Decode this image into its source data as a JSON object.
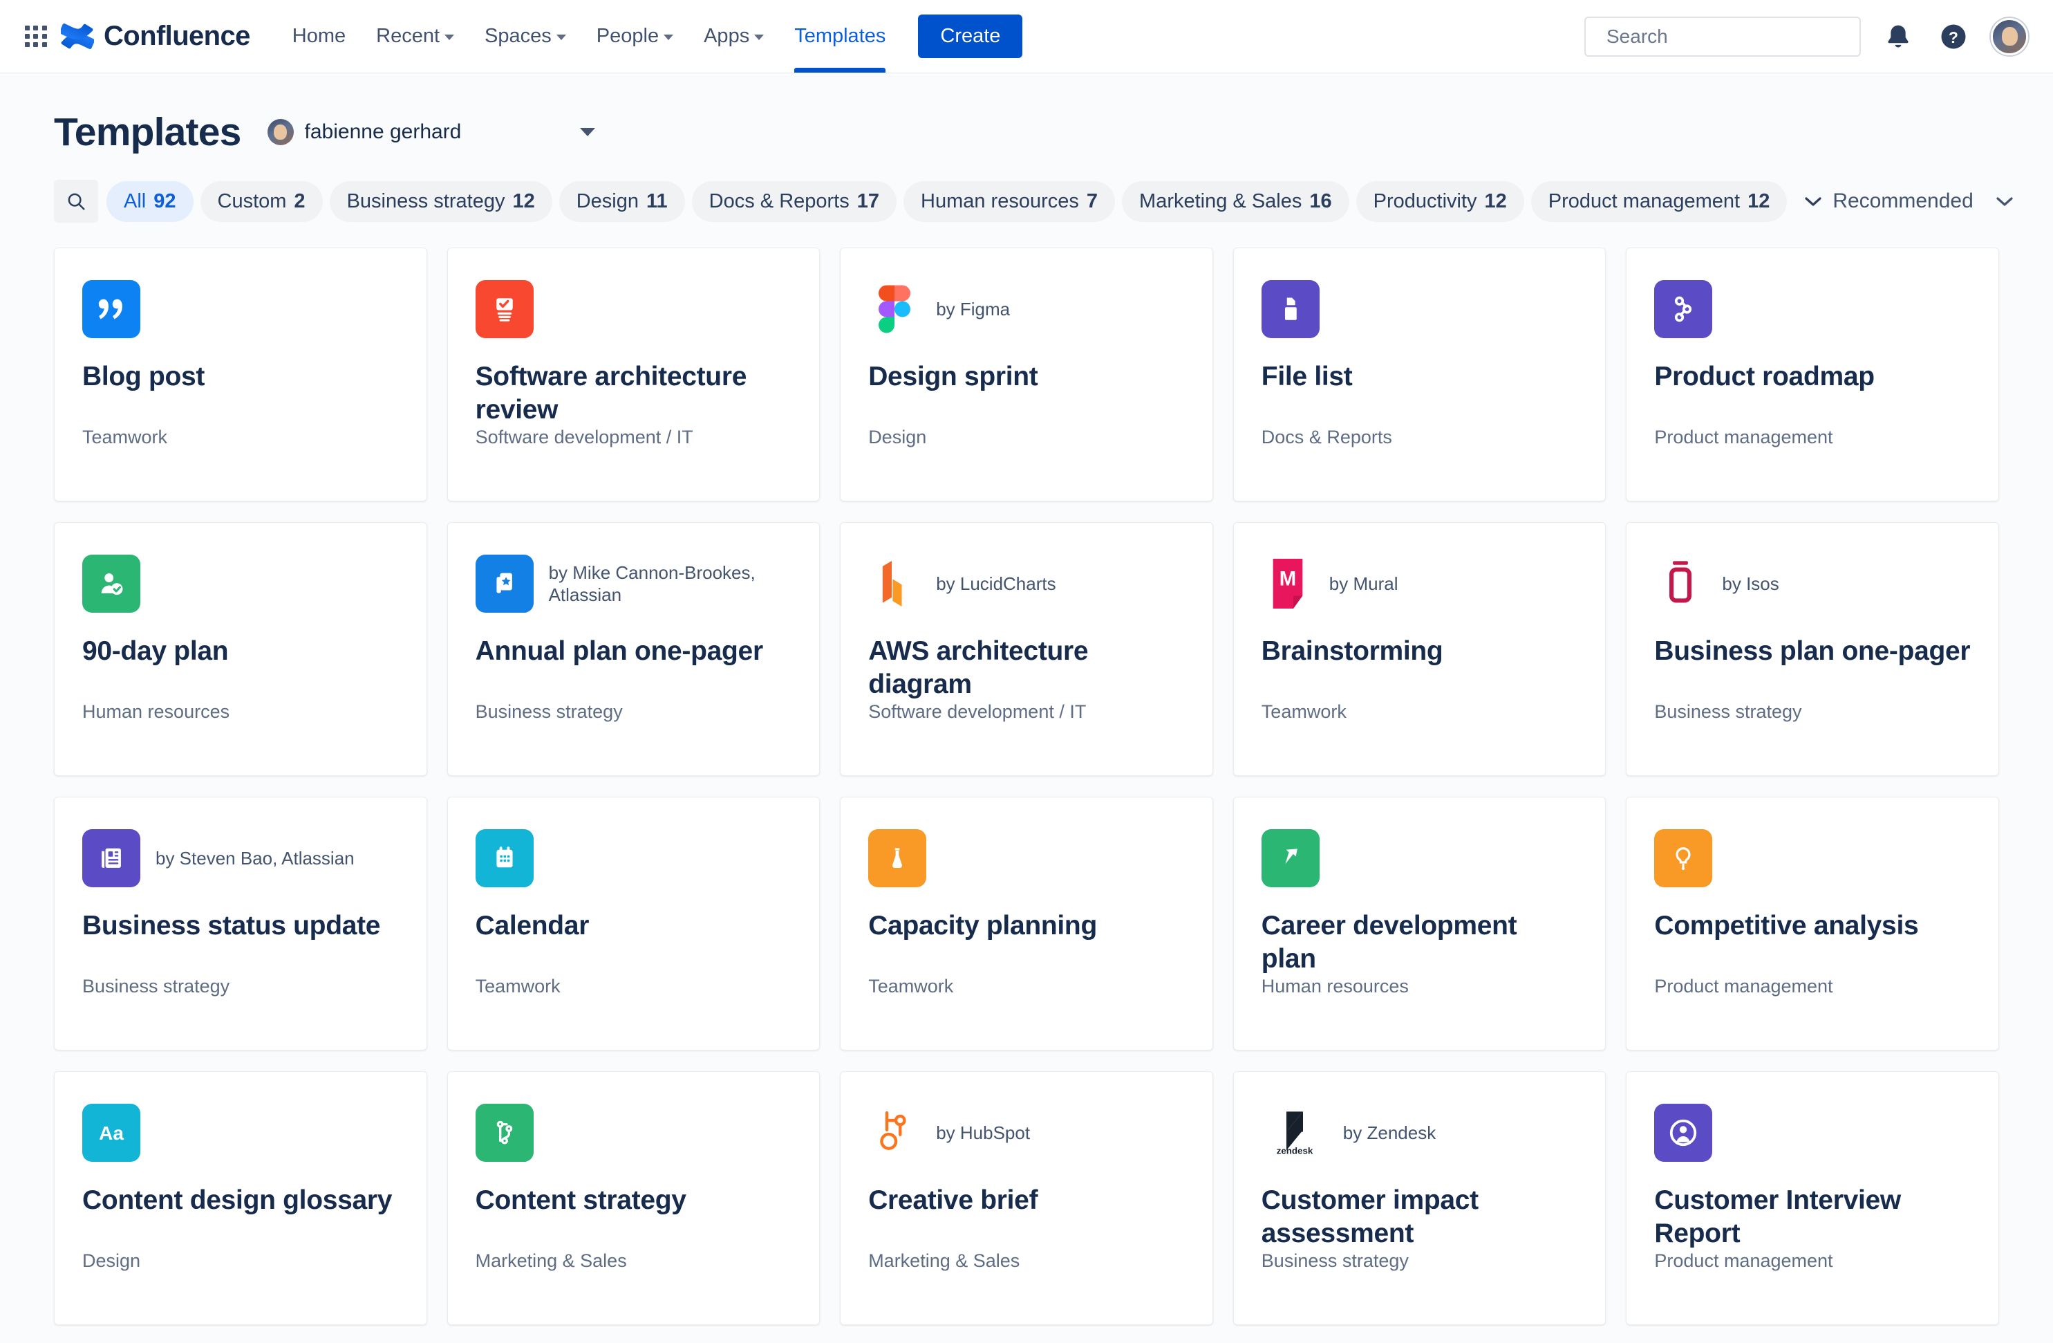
{
  "nav": {
    "app_switcher": "app-switcher-icon",
    "brand": "Confluence",
    "items": [
      {
        "label": "Home",
        "has_caret": false,
        "active": false
      },
      {
        "label": "Recent",
        "has_caret": true,
        "active": false
      },
      {
        "label": "Spaces",
        "has_caret": true,
        "active": false
      },
      {
        "label": "People",
        "has_caret": true,
        "active": false
      },
      {
        "label": "Apps",
        "has_caret": true,
        "active": false
      },
      {
        "label": "Templates",
        "has_caret": false,
        "active": true
      }
    ],
    "create_label": "Create",
    "search_placeholder": "Search",
    "search_value": "",
    "icons": [
      "search-icon",
      "notifications-bell-icon",
      "help-question-icon",
      "user-avatar"
    ]
  },
  "header": {
    "title": "Templates",
    "owner": "fabienne gerhard",
    "owner_caret": "chevron-down-icon"
  },
  "filters": {
    "search_icon": "search-icon",
    "more_icon": "chevron-down-icon",
    "chips": [
      {
        "label": "All",
        "count": "92",
        "selected": true
      },
      {
        "label": "Custom",
        "count": "2",
        "selected": false
      },
      {
        "label": "Business strategy",
        "count": "12",
        "selected": false
      },
      {
        "label": "Design",
        "count": "11",
        "selected": false
      },
      {
        "label": "Docs & Reports",
        "count": "17",
        "selected": false
      },
      {
        "label": "Human resources",
        "count": "7",
        "selected": false
      },
      {
        "label": "Marketing & Sales",
        "count": "16",
        "selected": false
      },
      {
        "label": "Productivity",
        "count": "12",
        "selected": false
      },
      {
        "label": "Product management",
        "count": "12",
        "selected": false
      }
    ],
    "sort_label": "Recommended",
    "sort_caret": "chevron-down-icon"
  },
  "templates": [
    {
      "title": "Blog post",
      "category": "Teamwork",
      "byline": "",
      "icon": "quote-icon",
      "tile_color": "#0c82f3"
    },
    {
      "title": "Software architecture review",
      "category": "Software development / IT",
      "byline": "",
      "icon": "checklist-document-icon",
      "tile_color": "#f8482f"
    },
    {
      "title": "Design sprint",
      "category": "Design",
      "byline": "by Figma",
      "icon": "figma-logo-icon",
      "tile_color": "transparent"
    },
    {
      "title": "File list",
      "category": "Docs & Reports",
      "byline": "",
      "icon": "folder-file-icon",
      "tile_color": "#5b4bc4"
    },
    {
      "title": "Product roadmap",
      "category": "Product management",
      "byline": "",
      "icon": "roadmap-nodes-icon",
      "tile_color": "#5b4bc4"
    },
    {
      "title": "90-day plan",
      "category": "Human resources",
      "byline": "",
      "icon": "person-check-icon",
      "tile_color": "#2bb673"
    },
    {
      "title": "Annual plan one-pager",
      "category": "Business strategy",
      "byline": "by Mike Cannon-Brookes, Atlassian",
      "icon": "star-document-icon",
      "tile_color": "#1380e5"
    },
    {
      "title": "AWS architecture diagram",
      "category": "Software development / IT",
      "byline": "by LucidCharts",
      "icon": "lucidcharts-logo-icon",
      "tile_color": "transparent"
    },
    {
      "title": "Brainstorming",
      "category": "Teamwork",
      "byline": "by Mural",
      "icon": "mural-logo-icon",
      "tile_color": "transparent"
    },
    {
      "title": "Business plan one-pager",
      "category": "Business strategy",
      "byline": "by Isos",
      "icon": "isos-logo-icon",
      "tile_color": "transparent"
    },
    {
      "title": "Business status update",
      "category": "Business strategy",
      "byline": "by Steven Bao, Atlassian",
      "icon": "newspaper-icon",
      "tile_color": "#5b4bc4"
    },
    {
      "title": "Calendar",
      "category": "Teamwork",
      "byline": "",
      "icon": "calendar-icon",
      "tile_color": "#13b5d6"
    },
    {
      "title": "Capacity planning",
      "category": "Teamwork",
      "byline": "",
      "icon": "flask-icon",
      "tile_color": "#f99a27"
    },
    {
      "title": "Career development plan",
      "category": "Human resources",
      "byline": "",
      "icon": "arrow-growth-icon",
      "tile_color": "#2bb673"
    },
    {
      "title": "Competitive analysis",
      "category": "Product management",
      "byline": "",
      "icon": "lightbulb-icon",
      "tile_color": "#f99a27"
    },
    {
      "title": "Content design glossary",
      "category": "Design",
      "byline": "",
      "icon": "typography-aa-icon",
      "tile_color": "#13b5d6"
    },
    {
      "title": "Content strategy",
      "category": "Marketing & Sales",
      "byline": "",
      "icon": "branch-flow-icon",
      "tile_color": "#2bb673"
    },
    {
      "title": "Creative brief",
      "category": "Marketing & Sales",
      "byline": "by HubSpot",
      "icon": "hubspot-logo-icon",
      "tile_color": "transparent"
    },
    {
      "title": "Customer impact assessment",
      "category": "Business strategy",
      "byline": "by Zendesk",
      "icon": "zendesk-logo-icon",
      "tile_color": "transparent"
    },
    {
      "title": "Customer Interview Report",
      "category": "Product management",
      "byline": "",
      "icon": "person-circle-icon",
      "tile_color": "#5b4bc4"
    }
  ],
  "colors": {
    "brand_blue": "#0052cc",
    "accent_link": "#0c5ed9",
    "text_primary": "#172b4d",
    "text_muted": "#5e6c84",
    "page_bg": "#fafbfc",
    "chip_bg": "#f1f2f4",
    "chip_selected_bg": "#e4eefc"
  }
}
